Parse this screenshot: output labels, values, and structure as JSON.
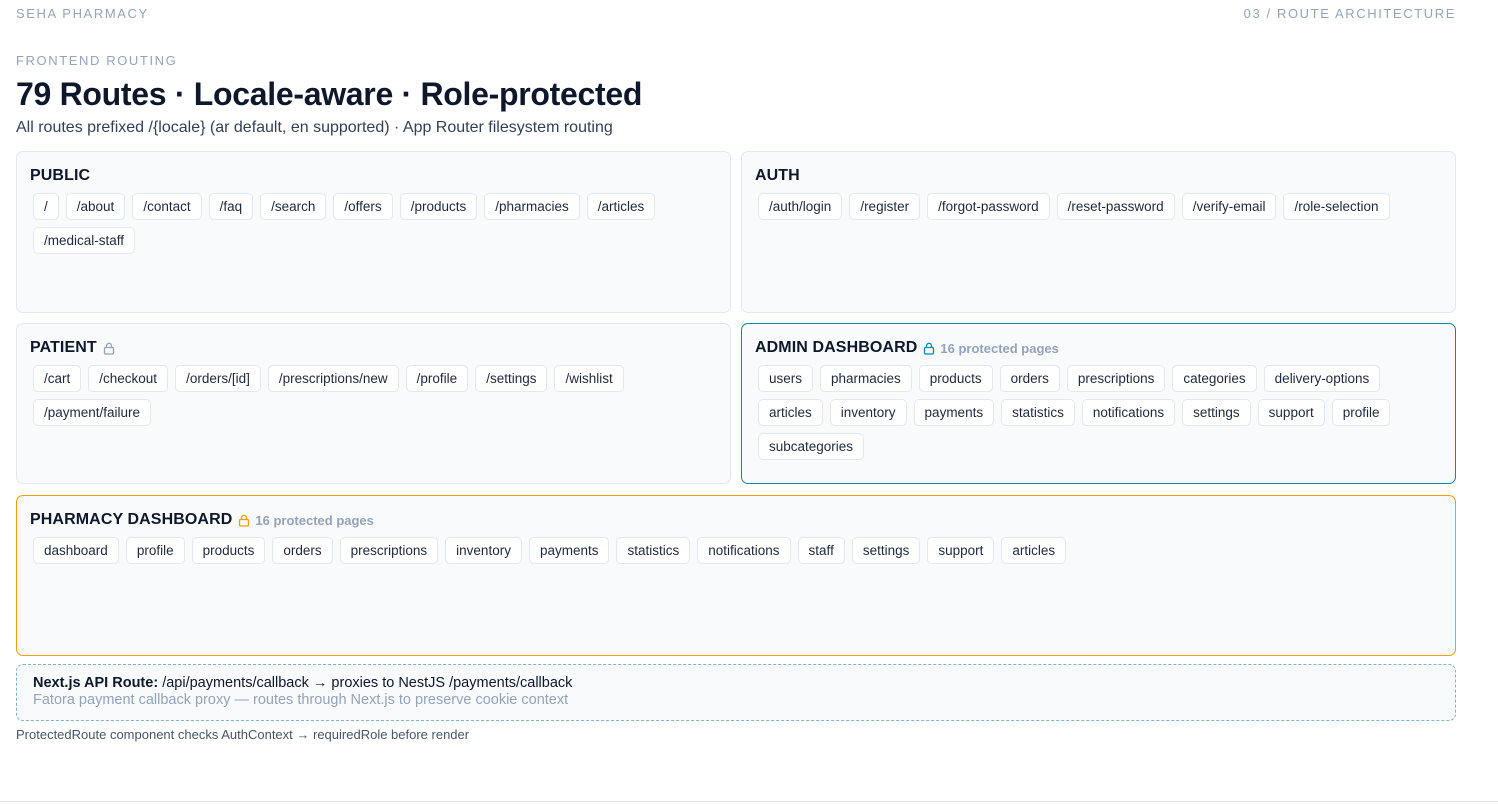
{
  "header": {
    "brand": "SEHA PHARMACY",
    "section": "03 / ROUTE ARCHITECTURE"
  },
  "eyebrow": "FRONTEND ROUTING",
  "title": "79 Routes · Locale-aware · Role-protected",
  "subtitle": "All routes prefixed /{locale} (ar default, en supported) · App Router filesystem routing",
  "colors": {
    "admin_accent": "#0e87a8",
    "pharmacy_accent": "#f59e0b",
    "muted": "#94a3b8"
  },
  "groups": {
    "public": {
      "title": "PUBLIC",
      "routes": [
        "/",
        "/about",
        "/contact",
        "/faq",
        "/search",
        "/offers",
        "/products",
        "/pharmacies",
        "/articles",
        "/medical-staff"
      ]
    },
    "auth": {
      "title": "AUTH",
      "routes": [
        "/auth/login",
        "/register",
        "/forgot-password",
        "/reset-password",
        "/verify-email",
        "/role-selection"
      ]
    },
    "patient": {
      "title": "PATIENT",
      "icon": "lock-icon",
      "routes": [
        "/cart",
        "/checkout",
        "/orders/[id]",
        "/prescriptions/new",
        "/profile",
        "/settings",
        "/wishlist",
        "/payment/failure"
      ]
    },
    "admin": {
      "title": "ADMIN DASHBOARD",
      "icon": "lock-icon",
      "meta": "16 protected pages",
      "routes": [
        "users",
        "pharmacies",
        "products",
        "orders",
        "prescriptions",
        "categories",
        "delivery-options",
        "articles",
        "inventory",
        "payments",
        "statistics",
        "notifications",
        "settings",
        "support",
        "profile",
        "subcategories"
      ]
    },
    "pharmacy": {
      "title": "PHARMACY DASHBOARD",
      "icon": "lock-icon",
      "meta": "16 protected pages",
      "routes": [
        "dashboard",
        "profile",
        "products",
        "orders",
        "prescriptions",
        "inventory",
        "payments",
        "statistics",
        "notifications",
        "staff",
        "settings",
        "support",
        "articles"
      ]
    }
  },
  "api_route": {
    "label": "Next.js API Route:",
    "path": "/api/payments/callback → proxies to NestJS /payments/callback",
    "note": "Fatora payment callback proxy — routes through Next.js to preserve cookie context"
  },
  "footnote": "ProtectedRoute component checks AuthContext → requiredRole before render"
}
